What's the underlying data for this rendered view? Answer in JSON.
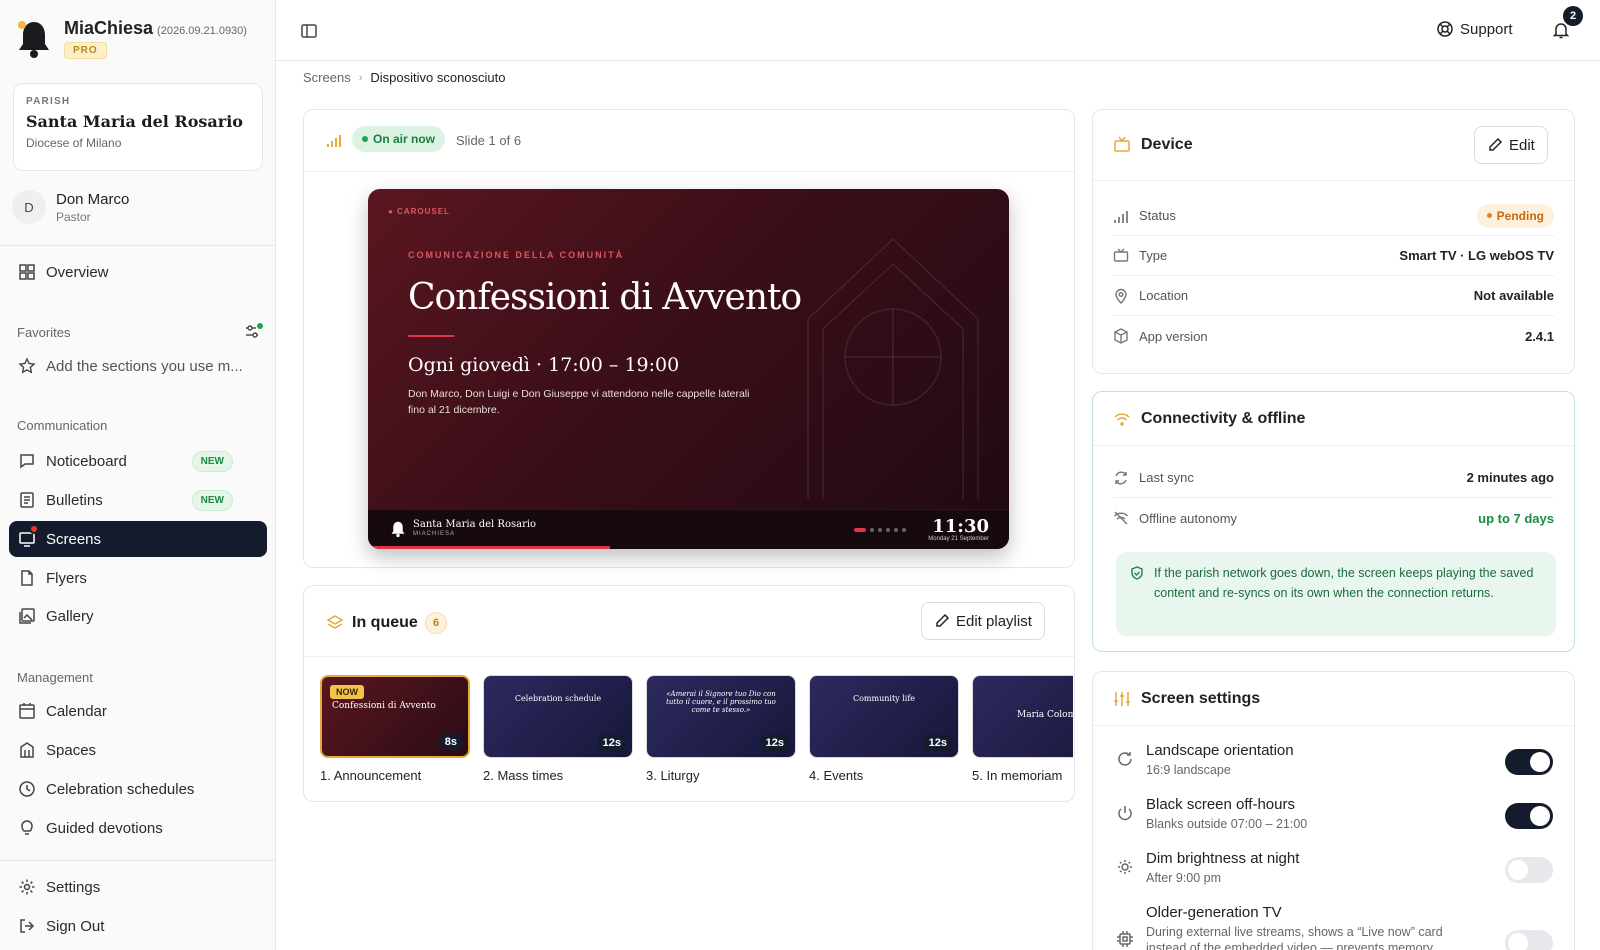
{
  "app": {
    "name": "MiaChiesa",
    "version": "(2026.09.21.0930)",
    "tier": "PRO"
  },
  "parish": {
    "label": "PARISH",
    "name": "Santa Maria del Rosario",
    "diocese": "Diocese of Milano"
  },
  "user": {
    "initial": "D",
    "name": "Don Marco",
    "role": "Pastor"
  },
  "nav": {
    "overview": "Overview",
    "favorites_label": "Favorites",
    "favorites_hint": "Add the sections you use m...",
    "communication_label": "Communication",
    "noticeboard": "Noticeboard",
    "bulletins": "Bulletins",
    "screens": "Screens",
    "flyers": "Flyers",
    "gallery": "Gallery",
    "management_label": "Management",
    "calendar": "Calendar",
    "spaces": "Spaces",
    "celebration_schedules": "Celebration schedules",
    "guided_devotions": "Guided devotions",
    "settings": "Settings",
    "sign_out": "Sign Out",
    "new_badge": "NEW"
  },
  "header": {
    "support": "Support",
    "notifications_count": "2"
  },
  "breadcrumb": {
    "parent": "Screens",
    "current": "Dispositivo sconosciuto"
  },
  "preview": {
    "status": "On air now",
    "slide_counter": "Slide 1 of 6",
    "slide": {
      "tag": "● CAROUSEL",
      "kicker": "COMUNICAZIONE DELLA COMUNITÀ",
      "title": "Confessioni di Avvento",
      "time": "Ogni giovedì · 17:00 – 19:00",
      "description": "Don Marco, Don Luigi e Don Giuseppe vi attendono nelle cappelle laterali fino al 21 dicembre.",
      "footer_parish": "Santa Maria del Rosario",
      "footer_brand": "MIACHIESA",
      "clock": "11:30",
      "date": "Monday 21 September"
    }
  },
  "queue": {
    "title": "In queue",
    "count": "6",
    "edit_label": "Edit playlist",
    "now_label": "NOW",
    "items": [
      {
        "label": "1. Announcement",
        "duration": "8s",
        "thumb_title": "Confessioni di Avvento"
      },
      {
        "label": "2. Mass times",
        "duration": "12s",
        "thumb_title": "Celebration schedule"
      },
      {
        "label": "3. Liturgy",
        "duration": "12s",
        "thumb_title": "«Amerai il Signore tuo Dio con tutto il cuore, e il prossimo tuo come te stesso.»"
      },
      {
        "label": "4. Events",
        "duration": "12s",
        "thumb_title": "Community life"
      },
      {
        "label": "5. In memoriam",
        "duration": "",
        "thumb_title": "Maria Colombo"
      }
    ]
  },
  "device": {
    "title": "Device",
    "edit_label": "Edit",
    "rows": {
      "status_label": "Status",
      "status_value": "Pending",
      "type_label": "Type",
      "type_value": "Smart TV · LG webOS TV",
      "location_label": "Location",
      "location_value": "Not available",
      "app_version_label": "App version",
      "app_version_value": "2.4.1"
    }
  },
  "connectivity": {
    "title": "Connectivity & offline",
    "last_sync_label": "Last sync",
    "last_sync_value": "2 minutes ago",
    "autonomy_label": "Offline autonomy",
    "autonomy_value": "up to 7 days",
    "notice": "If the parish network goes down, the screen keeps playing the saved content and re-syncs on its own when the connection returns."
  },
  "screen_settings": {
    "title": "Screen settings",
    "items": [
      {
        "title": "Landscape orientation",
        "sub": "16:9 landscape",
        "on": true
      },
      {
        "title": "Black screen off-hours",
        "sub": "Blanks outside 07:00 – 21:00",
        "on": true
      },
      {
        "title": "Dim brightness at night",
        "sub": "After 9:00 pm",
        "on": false
      },
      {
        "title": "Older-generation TV",
        "sub": "During external live streams, shows a “Live now” card instead of the embedded video — prevents memory",
        "on": false
      }
    ]
  },
  "colors": {
    "accent_dark": "#141b2d",
    "live_green": "#1fa251",
    "pending_orange": "#c56a11",
    "slide_red": "#e03548"
  }
}
